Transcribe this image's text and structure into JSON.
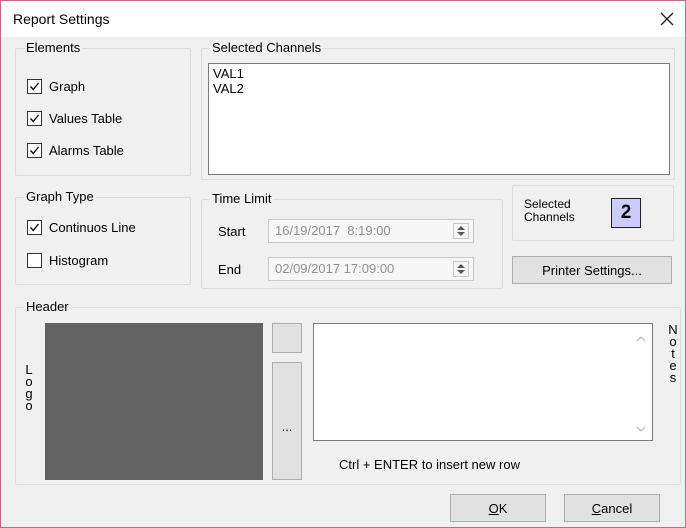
{
  "window": {
    "title": "Report Settings"
  },
  "elements": {
    "legend": "Elements",
    "items": [
      {
        "label": "Graph",
        "checked": true
      },
      {
        "label": "Values Table",
        "checked": true
      },
      {
        "label": "Alarms Table",
        "checked": true
      }
    ]
  },
  "selected_channels": {
    "legend": "Selected Channels",
    "items": [
      "VAL1",
      "VAL2"
    ]
  },
  "graph_type": {
    "legend": "Graph Type",
    "items": [
      {
        "label": "Continuos Line",
        "checked": true
      },
      {
        "label": "Histogram",
        "checked": false
      }
    ]
  },
  "time_limit": {
    "legend": "Time Limit",
    "start_label": "Start",
    "start_value": "16/19/2017  8:19:00",
    "end_label": "End",
    "end_value": "02/09/2017 17:09:00"
  },
  "channels_count": {
    "label_line1": "Selected",
    "label_line2": "Channels",
    "value": "2",
    "badge_color": "#ccccff"
  },
  "buttons": {
    "printer_settings": "Printer Settings...",
    "browse": "...",
    "ok_mnemonic": "O",
    "ok_rest": "K",
    "cancel_mnemonic": "C",
    "cancel_rest": "ancel"
  },
  "header": {
    "legend": "Header",
    "logo_letters": [
      "L",
      "o",
      "g",
      "o"
    ],
    "notes_letters": [
      "N",
      "o",
      "t",
      "e",
      "s"
    ],
    "notes_value": "",
    "hint": "Ctrl + ENTER to insert new row",
    "logo_bg": "#636363"
  }
}
